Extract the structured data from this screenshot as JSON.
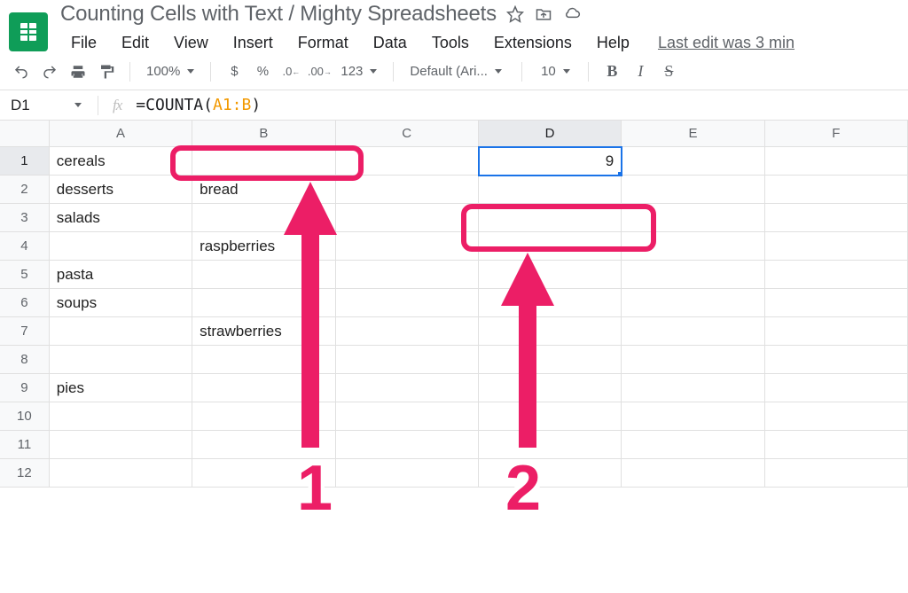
{
  "header": {
    "doc_title": "Counting Cells with Text / Mighty Spreadsheets",
    "last_edit": "Last edit was 3 min",
    "menu": [
      "File",
      "Edit",
      "View",
      "Insert",
      "Format",
      "Data",
      "Tools",
      "Extensions",
      "Help"
    ]
  },
  "toolbar": {
    "zoom": "100%",
    "currency": "$",
    "percent": "%",
    "dec_minus": ".0",
    "dec_plus": ".00",
    "more_formats": "123",
    "font": "Default (Ari...",
    "font_size": "10",
    "bold": "B",
    "italic": "I",
    "strike": "S"
  },
  "formula_bar": {
    "cell_ref": "D1",
    "fx_label": "fx",
    "prefix": "=COUNTA(",
    "range": "A1:B",
    "suffix": ")"
  },
  "grid": {
    "columns": [
      "A",
      "B",
      "C",
      "D",
      "E",
      "F"
    ],
    "rows_shown": 12,
    "selected_col": "D",
    "selected_row": 1,
    "cells": {
      "A1": "cereals",
      "A2": "desserts",
      "A3": "salads",
      "A4": "",
      "A5": "pasta",
      "A6": "soups",
      "A7": "",
      "A8": "",
      "A9": "pies",
      "A10": "",
      "A11": "",
      "A12": "",
      "B1": "",
      "B2": "bread",
      "B3": "",
      "B4": "raspberries",
      "B5": "",
      "B6": "",
      "B7": "strawberries",
      "B8": "",
      "B9": "",
      "B10": "",
      "B11": "",
      "B12": "",
      "D1": "9"
    }
  },
  "annotations": {
    "num1": "1",
    "num2": "2"
  }
}
